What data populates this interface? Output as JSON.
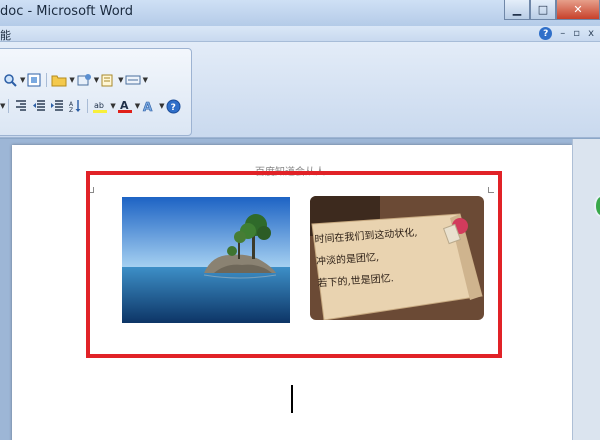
{
  "window": {
    "title": "doc - Microsoft Word",
    "btn_min": "▁",
    "btn_max": "□",
    "btn_close": "✕"
  },
  "menubar": {
    "label": "能",
    "help": "?",
    "ctrl_min": "–",
    "ctrl_restore": "▫",
    "ctrl_close": "x"
  },
  "ribbon": {
    "highlight_color": "#f7ef3c",
    "font_color": "#e0201a"
  },
  "document": {
    "header_text": "百度知道会从人",
    "note_lines": [
      "时间在我们到这动状化,",
      "冲淡的是团忆,",
      "若下的,世是团忆."
    ],
    "frame_color": "#e12227"
  },
  "icons": [
    "zoom-icon",
    "fit-page-icon",
    "folder-icon",
    "styles-icon",
    "paste-format-icon",
    "box-icon",
    "align-right-icon",
    "indent-increase-icon",
    "indent-decrease-icon",
    "sort-icon",
    "highlight-icon",
    "font-color-icon",
    "text-effect-icon",
    "help-icon"
  ]
}
